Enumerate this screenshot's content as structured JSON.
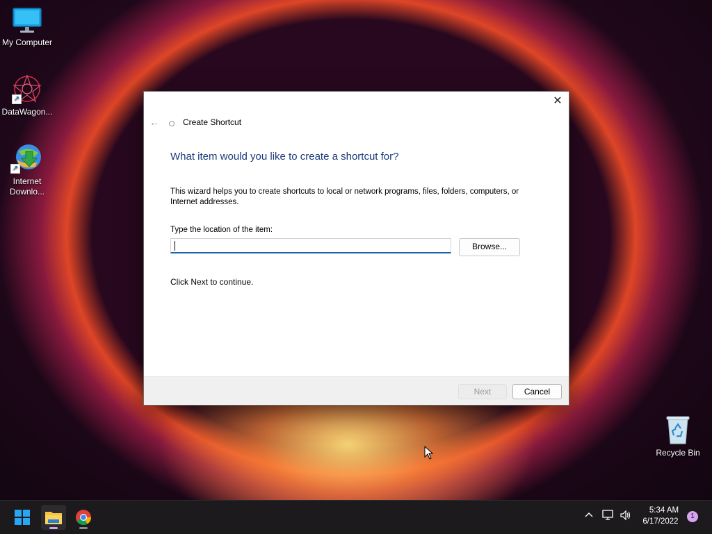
{
  "desktop": {
    "icons": [
      {
        "label": "My Computer"
      },
      {
        "label": "DataWagon..."
      },
      {
        "label_line1": "Internet",
        "label_line2": "Downlo..."
      },
      {
        "label": "Recycle Bin"
      }
    ]
  },
  "dialog": {
    "window_title": "Create Shortcut",
    "heading": "What item would you like to create a shortcut for?",
    "description": "This wizard helps you to create shortcuts to local or network programs, files, folders, computers, or Internet addresses.",
    "location_label": "Type the location of the item:",
    "location_value": "",
    "browse_label": "Browse...",
    "continue_text": "Click Next to continue.",
    "next_label": "Next",
    "cancel_label": "Cancel",
    "close_glyph": "✕",
    "back_glyph": "←"
  },
  "taskbar": {
    "time": "5:34 AM",
    "date": "6/17/2022",
    "notification_count": "1",
    "apps": [
      "start-icon",
      "file-explorer-icon",
      "chrome-icon"
    ],
    "tray": [
      "chevron-up-icon",
      "network-icon",
      "volume-icon"
    ]
  },
  "colors": {
    "heading": "#1a3a7a",
    "accent": "#1f5fb0",
    "taskbar": "#1d1a1e"
  }
}
